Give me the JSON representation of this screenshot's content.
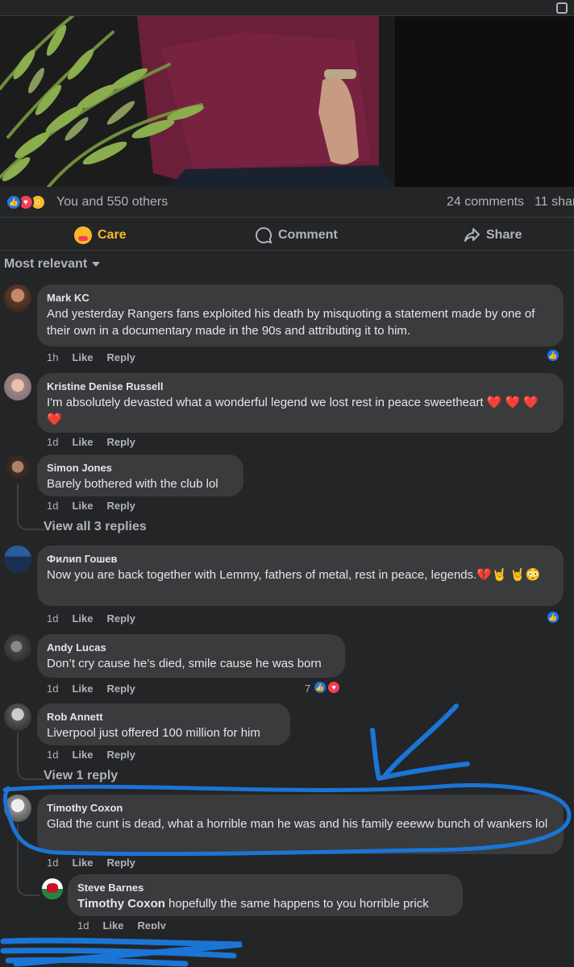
{
  "post": {
    "reactions": {
      "icons": [
        "like-icon",
        "love-icon",
        "care-icon"
      ],
      "summary": "You and 550 others"
    },
    "comment_count": "24 comments",
    "share_count": "11 shar"
  },
  "actions": {
    "care": "Care",
    "comment": "Comment",
    "share": "Share"
  },
  "sort": {
    "label": "Most relevant"
  },
  "comments": [
    {
      "name": "Mark KC",
      "text": "And yesterday Rangers fans exploited his death by misquoting a statement made by one of their own in a documentary made in the 90s and attributing it to him.",
      "time": "1h",
      "like": "Like",
      "reply": "Reply"
    },
    {
      "name": "Kristine Denise Russell",
      "text": "I'm absolutely devasted what a wonderful legend we lost rest in peace sweetheart ❤️ ❤️ ❤️ ❤️",
      "time": "1d",
      "like": "Like",
      "reply": "Reply"
    },
    {
      "name": "Simon Jones",
      "text": "Barely bothered with the club lol",
      "time": "1d",
      "like": "Like",
      "reply": "Reply",
      "view_replies": "View all 3 replies"
    },
    {
      "name": "Филип Гошев",
      "text": "Now you are back together with Lemmy, fathers of metal, rest in peace, legends.💔🤘 🤘😳",
      "time": "1d",
      "like": "Like",
      "reply": "Reply"
    },
    {
      "name": "Andy Lucas",
      "text": "Don’t cry cause he’s died, smile cause he was born",
      "time": "1d",
      "like": "Like",
      "reply": "Reply",
      "reaction_count": "7"
    },
    {
      "name": "Rob Annett",
      "text": "Liverpool just offered 100 million for him",
      "time": "1d",
      "like": "Like",
      "reply": "Reply",
      "view_replies": "View 1 reply"
    },
    {
      "name": "Timothy Coxon",
      "text": "Glad the cunt is dead, what a horrible man he was and his family eeeww bunch of wankers lol",
      "time": "1d",
      "like": "Like",
      "reply": "Reply"
    }
  ],
  "reply": {
    "name": "Steve Barnes",
    "tag": "Timothy Coxon",
    "text": " hopefully the same happens to you horrible prick",
    "time": "1d",
    "like": "Like",
    "reply": "Reply"
  },
  "colors": {
    "background": "#242526",
    "bubble": "#3a3b3c",
    "annotation": "#1a75d6",
    "care": "#f7b928"
  }
}
